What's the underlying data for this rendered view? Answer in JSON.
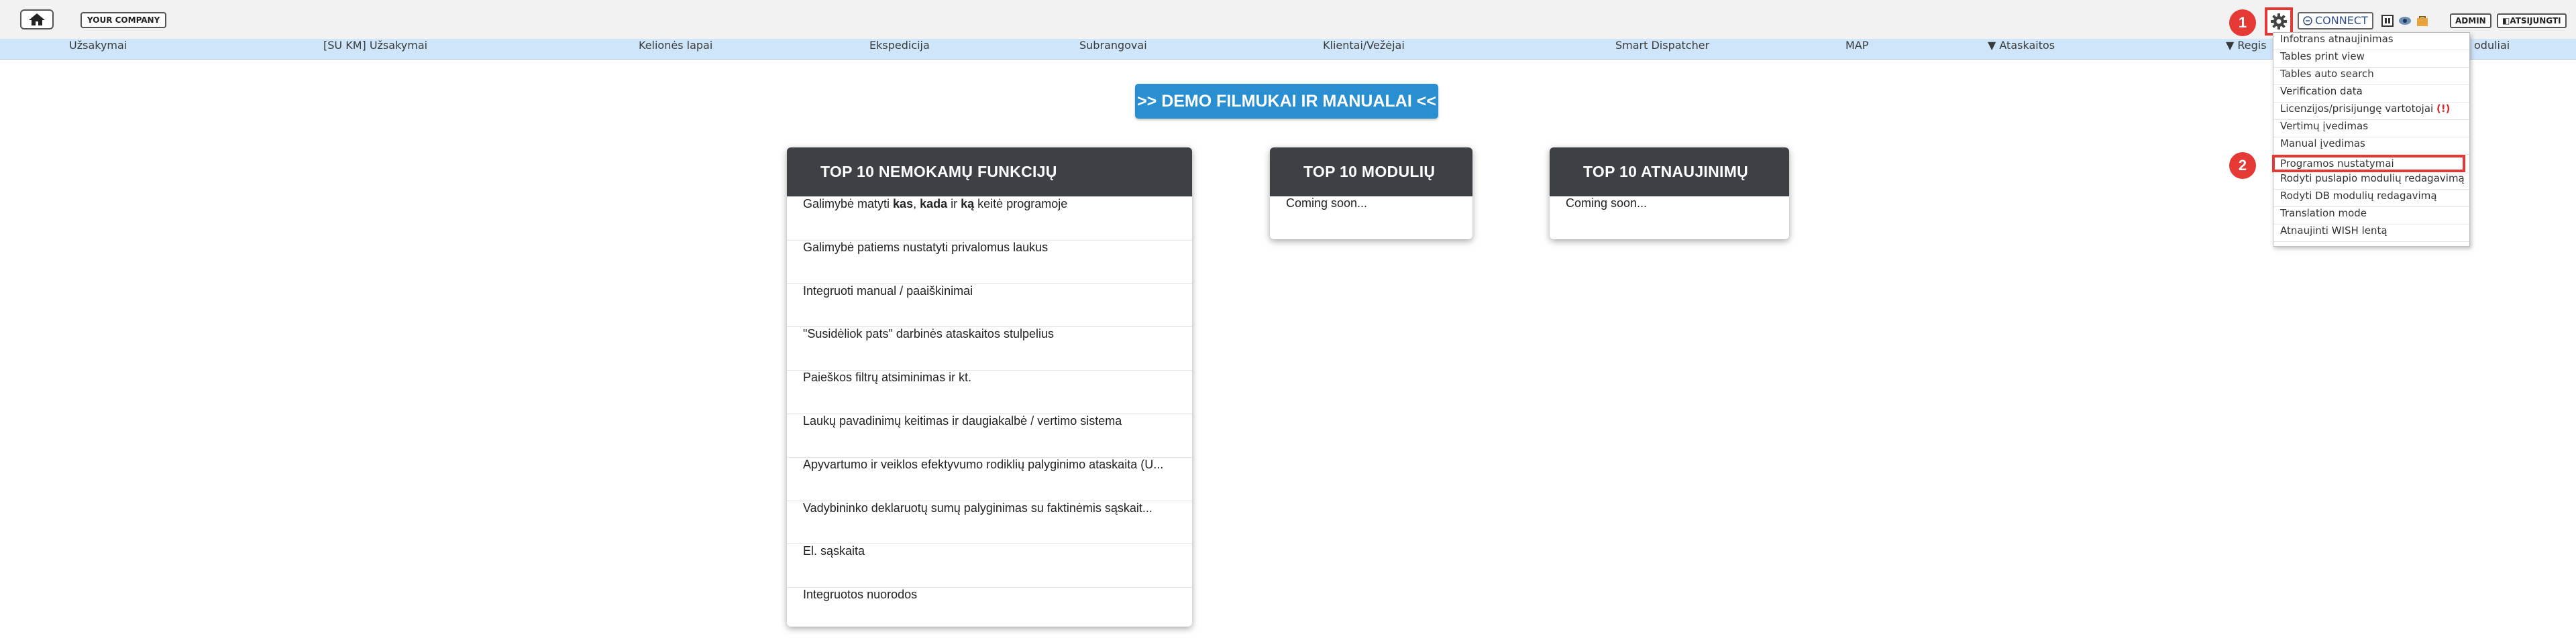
{
  "topbar": {
    "company_label": "YOUR COMPANY",
    "connect_label": "CONNECT",
    "admin_label": "ADMIN",
    "logout_label": "ATSIJUNGTI",
    "icons": [
      "home-icon",
      "gear-icon",
      "connect-icon",
      "grid-icon",
      "eye-icon",
      "bag-icon",
      "logout-icon"
    ]
  },
  "nav": {
    "items": [
      {
        "label": "Užsakymai"
      },
      {
        "label": "[SU KM] Užsakymai"
      },
      {
        "label": "Kelionės lapai"
      },
      {
        "label": "Ekspedicija"
      },
      {
        "label": "Subrangovai"
      },
      {
        "label": "Klientai/Vežėjai"
      },
      {
        "label": "Smart Dispatcher"
      },
      {
        "label": "MAP"
      },
      {
        "label": "▼ Ataskaitos"
      },
      {
        "label": "▼ Regis"
      },
      {
        "label": "oduliai"
      }
    ]
  },
  "demo_button": {
    "label": ">> DEMO FILMUKAI IR MANUALAI <<"
  },
  "cards": {
    "features": {
      "title": "TOP 10 NEMOKAMŲ FUNKCIJŲ",
      "row1": {
        "a": "Galimybė matyti ",
        "b1": "kas",
        "c": ", ",
        "b2": "kada",
        "d": " ir ",
        "b3": "ką",
        "e": " keitė programoje"
      },
      "items": [
        "Galimybė patiems nustatyti privalomus laukus",
        "Integruoti manual / paaiškinimai",
        "\"Susidėliok pats\" darbinės ataskaitos stulpelius",
        "Paieškos filtrų atsiminimas ir kt.",
        "Laukų pavadinimų keitimas ir daugiakalbė / vertimo sistema",
        "Apyvartumo ir veiklos efektyvumo rodiklių palyginimo ataskaita (U...",
        "Vadybininko deklaruotų sumų palyginimas su faktinėmis sąskait...",
        "El. sąskaita",
        "Integruotos nuorodos"
      ]
    },
    "modules": {
      "title": "TOP 10 MODULIŲ",
      "text": "Coming soon..."
    },
    "updates": {
      "title": "TOP 10 ATNAUJINIMŲ",
      "text": "Coming soon..."
    }
  },
  "dropdown": {
    "items": [
      {
        "label": "Infotrans atnaujinimas"
      },
      {
        "label": "Tables print view"
      },
      {
        "label": "Tables auto search"
      },
      {
        "label": "Verification data"
      },
      {
        "label": "Licenzijos/prisijungę vartotojai",
        "warn": "(!)"
      },
      {
        "label": "Vertimų įvedimas"
      },
      {
        "label": "Manual įvedimas"
      },
      {
        "label": "Programos nustatymai"
      },
      {
        "label": "Rodyti puslapio modulių redagavimą"
      },
      {
        "label": "Rodyti DB modulių redagavimą"
      },
      {
        "label": "Translation mode"
      },
      {
        "label": "Atnaujinti WISH lentą"
      }
    ]
  },
  "badges": {
    "step1": "1",
    "step2": "2"
  },
  "colors": {
    "accent_red": "#e53935",
    "demo_blue": "#2a8fd0",
    "nav_bg": "#cfe5f9",
    "card_header": "#3d4145"
  }
}
